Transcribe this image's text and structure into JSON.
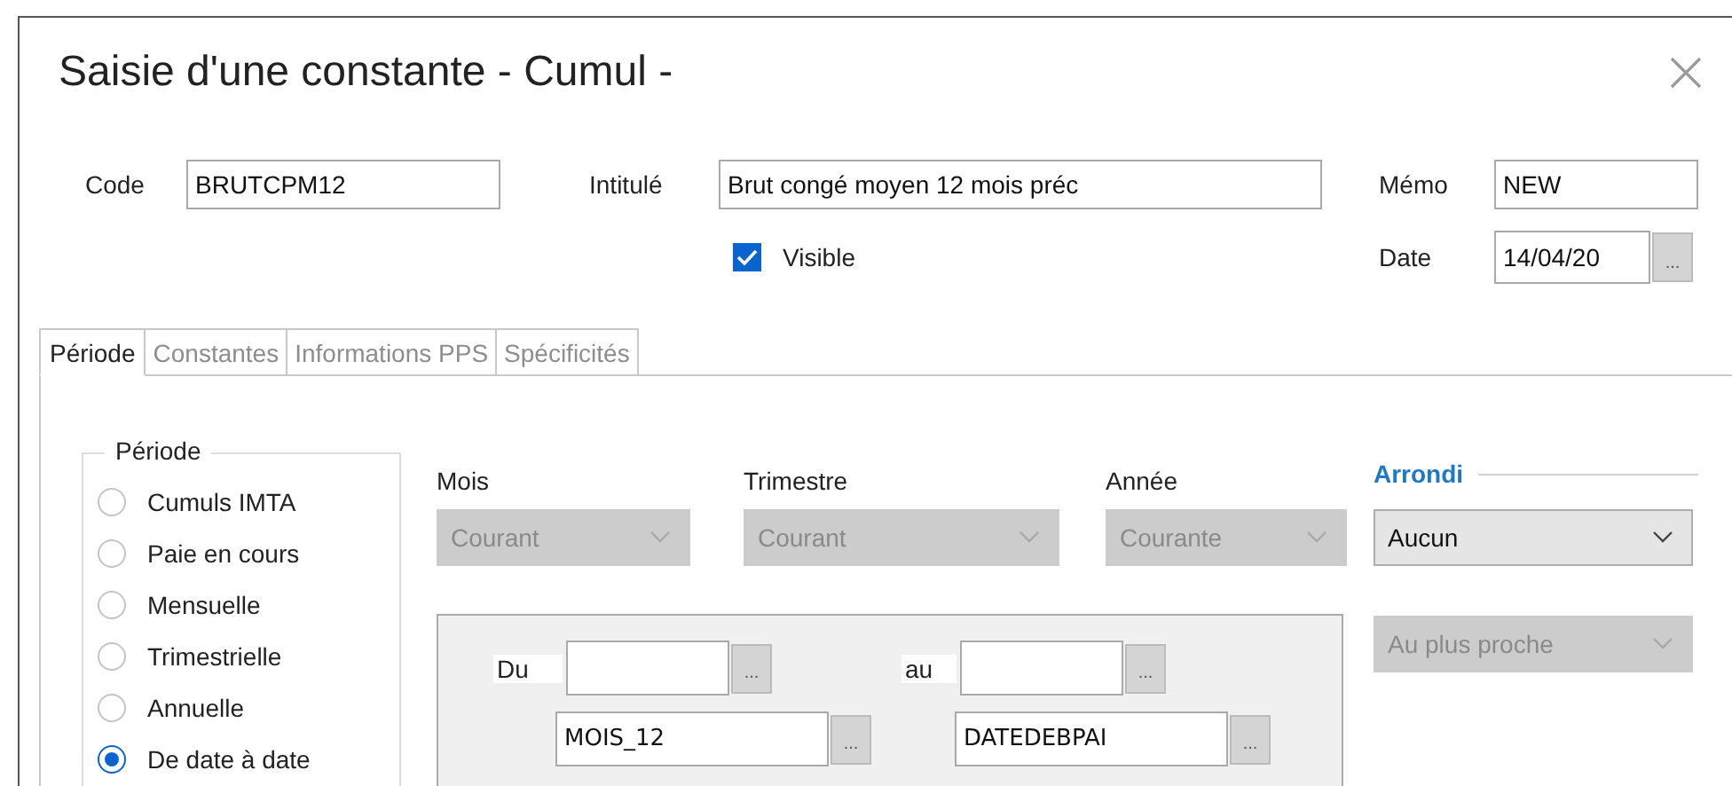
{
  "window": {
    "title": "Saisie d'une constante - Cumul -"
  },
  "code": {
    "label": "Code",
    "value": "BRUTCPM12"
  },
  "intitule": {
    "label": "Intitulé",
    "value": "Brut congé moyen 12 mois préc"
  },
  "memo": {
    "label": "Mémo",
    "value": "NEW"
  },
  "visible": {
    "label": "Visible",
    "checked": true
  },
  "date": {
    "label": "Date",
    "value": "14/04/20",
    "button": "..."
  },
  "tabs": [
    {
      "label": "Période",
      "selected": true
    },
    {
      "label": "Constantes",
      "selected": false
    },
    {
      "label": "Informations PPS",
      "selected": false
    },
    {
      "label": "Spécificités",
      "selected": false
    }
  ],
  "periode": {
    "title": "Période",
    "options": [
      {
        "label": "Cumuls IMTA",
        "selected": false
      },
      {
        "label": "Paie en cours",
        "selected": false
      },
      {
        "label": "Mensuelle",
        "selected": false
      },
      {
        "label": "Trimestrielle",
        "selected": false
      },
      {
        "label": "Annuelle",
        "selected": false
      },
      {
        "label": "De date à date",
        "selected": true
      }
    ]
  },
  "selectors": [
    {
      "label": "Mois",
      "value": "Courant",
      "disabled": true
    },
    {
      "label": "Trimestre",
      "value": "Courant",
      "disabled": true
    },
    {
      "label": "Année",
      "value": "Courante",
      "disabled": true
    }
  ],
  "range": [
    {
      "label": "Du",
      "date_button": "...",
      "variable": "MOIS_12",
      "variable_button": "..."
    },
    {
      "label": "au",
      "date_button": "...",
      "variable": "DATEDEBPAI",
      "variable_button": "..."
    }
  ],
  "arrondi": {
    "title": "Arrondi",
    "combos": [
      {
        "value": "Aucun",
        "disabled": false
      },
      {
        "value": "Au plus proche",
        "disabled": true
      }
    ]
  }
}
